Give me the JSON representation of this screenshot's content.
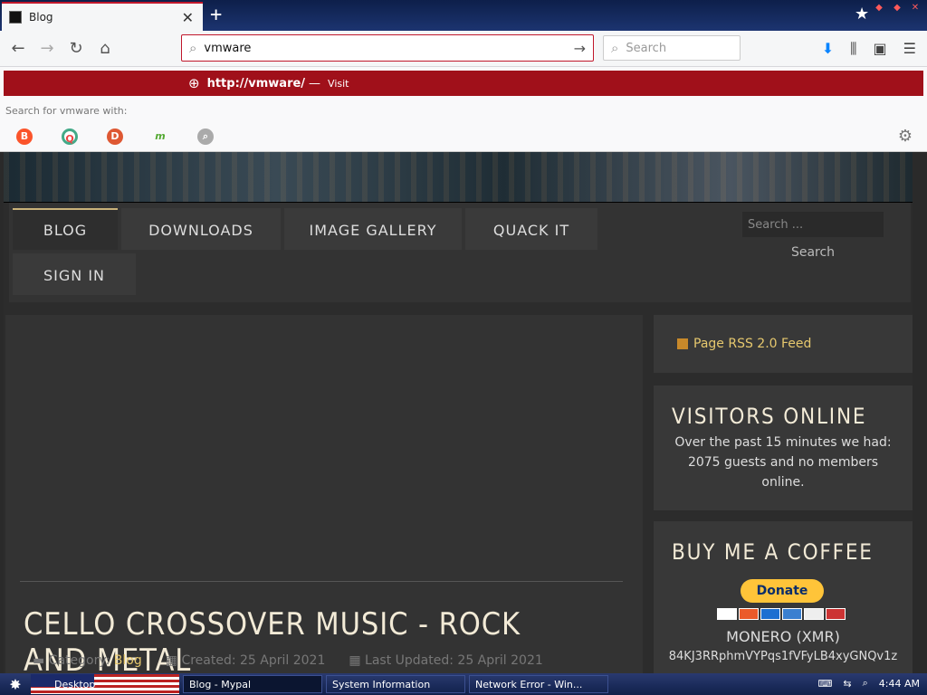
{
  "browser": {
    "tab_title": "Blog",
    "url_value": "vmware",
    "search_placeholder": "Search",
    "suggestion_url": "http://vmware/",
    "suggestion_dash": "—",
    "suggestion_action": "Visit",
    "search_for_text": "Search for vmware with:"
  },
  "site": {
    "menu": [
      "BLOG",
      "DOWNLOADS",
      "IMAGE GALLERY",
      "QUACK IT",
      "SIGN IN"
    ],
    "search_placeholder": "Search ...",
    "search_button": "Search",
    "article_title": "CELLO CROSSOVER MUSIC - ROCK AND METAL",
    "meta_category_label": "Category:",
    "meta_category_value": "Blog",
    "meta_created": "Created: 25 April 2021",
    "meta_updated": "Last Updated: 25 April 2021",
    "rss_text": "Page RSS 2.0 Feed",
    "visitors_title": "VISITORS ONLINE",
    "visitors_text": "Over the past 15 minutes we had: 2075 guests and no members online.",
    "coffee_title": "BUY ME A COFFEE",
    "donate_label": "Donate",
    "monero_label": "MONERO (XMR)",
    "monero_address": "84KJ3RRphmVYPqs1fVFyLB4xyGNQv1z"
  },
  "taskbar": {
    "items": [
      "Desktop",
      "Blog - Mypal",
      "System Information",
      "Network Error - Win..."
    ],
    "clock": "4:44 AM"
  },
  "colors": {
    "accent_red": "#c0172b",
    "gold": "#e6c86e"
  }
}
